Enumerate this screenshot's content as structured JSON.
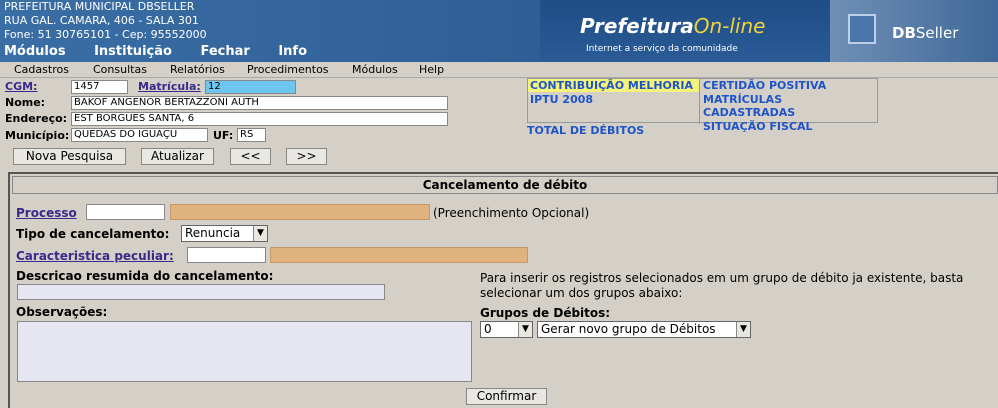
{
  "banner": {
    "line1": "PREFEITURA MUNICIPAL DBSELLER",
    "line2": "RUA GAL. CAMARA, 406 - SALA 301",
    "line3": "Fone: 51 30765101  -  Cep: 95552000",
    "menu": [
      "Módulos",
      "Instituição",
      "Fechar",
      "Info"
    ],
    "brand_main": "Prefeitura",
    "brand_online": "On-line",
    "brand_sub": "Internet a serviço da comunidade",
    "db_brand": "DB",
    "db_brand2": "Seller"
  },
  "menubar": [
    "Cadastros",
    "Consultas",
    "Relatórios",
    "Procedimentos",
    "Módulos",
    "Help"
  ],
  "form": {
    "cgm_label": "CGM:",
    "cgm_value": "1457",
    "matricula_label": "Matrícula:",
    "matricula_value": "12",
    "nome_label": "Nome:",
    "nome_value": "BAKOF ANGENOR BERTAZZONI AUTH",
    "endereco_label": "Endereço:",
    "endereco_value": "EST BORGUES SANTA, 6",
    "municipio_label": "Município:",
    "municipio_value": "QUEDAS DO IGUAÇU",
    "uf_label": "UF:",
    "uf_value": "RS"
  },
  "info": {
    "contribuicao": "CONTRIBUIÇÃO MELHORIA",
    "iptu": "IPTU 2008",
    "certidao": "CERTIDÃO POSITIVA",
    "matriculas": "MATRÍCULAS CADASTRADAS",
    "situacao": "SITUAÇÃO FISCAL",
    "total": "TOTAL DE DÉBITOS"
  },
  "buttons": {
    "nova_pesquisa": "Nova Pesquisa",
    "atualizar": "Atualizar",
    "prev": "<<",
    "next": ">>",
    "confirmar": "Confirmar"
  },
  "panel": {
    "title": "Cancelamento de débito",
    "processo_label": "Processo",
    "processo_hint": "(Preenchimento Opcional)",
    "tipo_label": "Tipo de cancelamento:",
    "tipo_value": "Renuncia",
    "caract_label": "Caracteristica peculiar:",
    "descricao_label": "Descricao resumida do cancelamento:",
    "observacoes_label": "Observações:",
    "grupos_info": "Para inserir os registros selecionados em um grupo de débito ja existente, basta selecionar um dos grupos abaixo:",
    "grupos_label": "Grupos de Débitos:",
    "grupo_num": "0",
    "grupo_option": "Gerar novo grupo de Débitos"
  }
}
